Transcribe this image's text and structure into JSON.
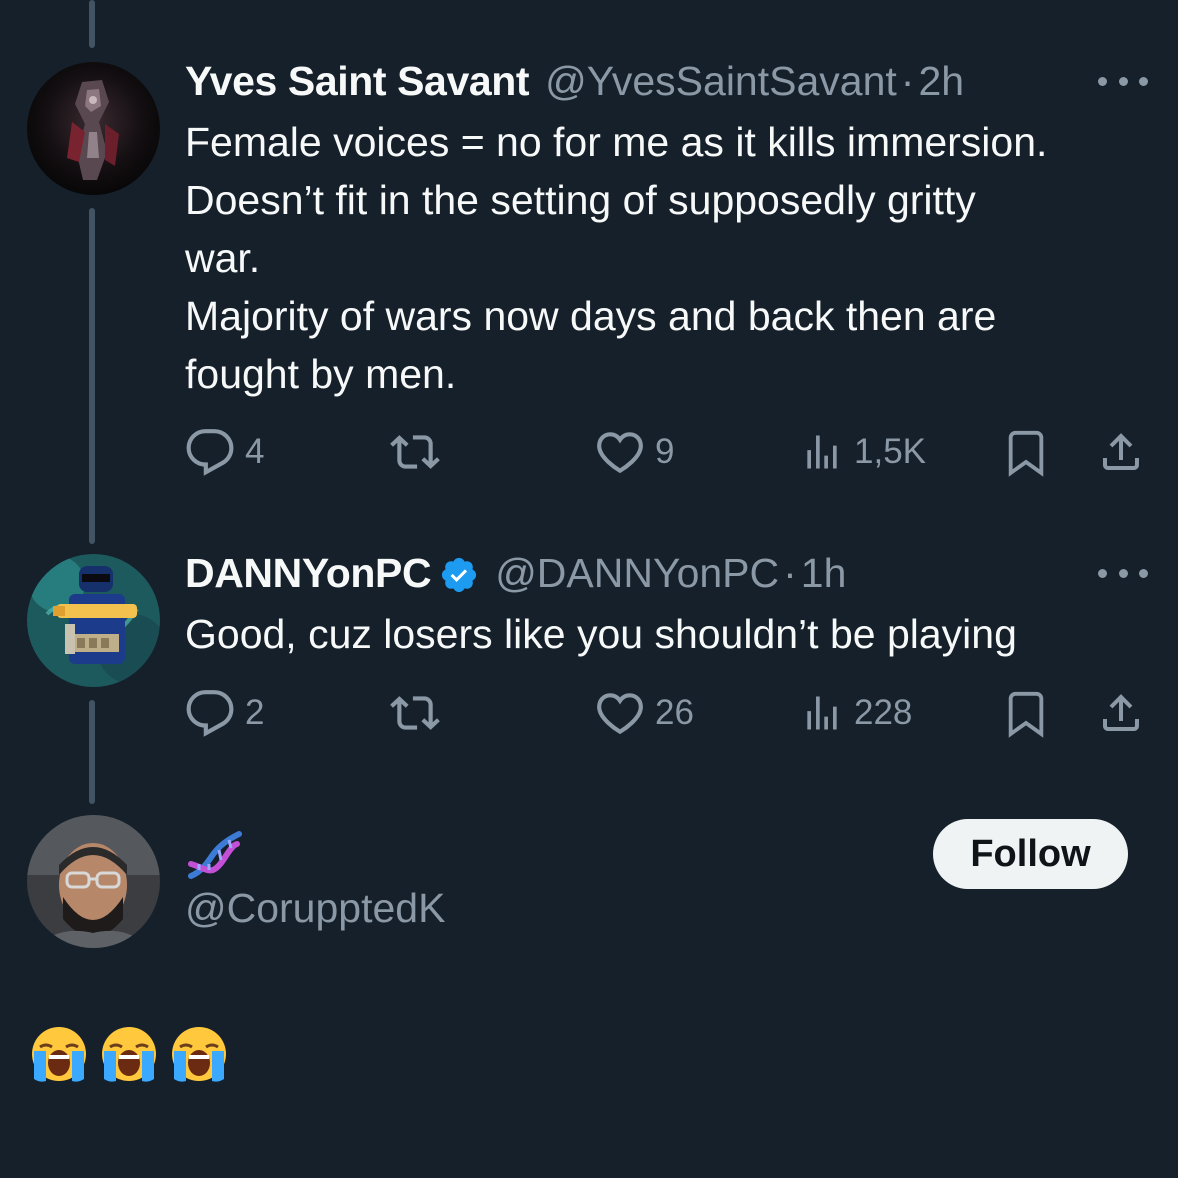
{
  "colors": {
    "background": "#15202b",
    "text_primary": "#f7f9f9",
    "text_secondary": "#8b98a5",
    "verified": "#1d9bf0",
    "thread_line": "#425364"
  },
  "tweets": [
    {
      "display_name": "Yves Saint Savant",
      "handle": "@YvesSaintSavant",
      "separator": "·",
      "time": "2h",
      "verified": false,
      "text_lines": [
        "Female voices = no for me as it kills immersion.",
        "Doesn’t fit in the setting of supposedly gritty",
        "war.",
        "Majority of wars now days and back then are",
        "fought by men."
      ],
      "actions": {
        "replies": "4",
        "reposts": "",
        "likes": "9",
        "views": "1,5K"
      },
      "icons": [
        "reply-icon",
        "repost-icon",
        "like-icon",
        "views-icon",
        "bookmark-icon",
        "share-icon",
        "more-icon"
      ]
    },
    {
      "display_name": "DANNYonPC",
      "handle": "@DANNYonPC",
      "separator": "·",
      "time": "1h",
      "verified": true,
      "text_lines": [
        "Good, cuz losers like you shouldn’t be playing"
      ],
      "actions": {
        "replies": "2",
        "reposts": "",
        "likes": "26",
        "views": "228"
      },
      "icons": [
        "reply-icon",
        "repost-icon",
        "like-icon",
        "views-icon",
        "bookmark-icon",
        "share-icon",
        "more-icon"
      ]
    }
  ],
  "focused_reply": {
    "display_name_icon": "dna-emoji-icon",
    "handle": "@CorupptedK",
    "follow_label": "Follow",
    "body_emoji": [
      "loudly-crying-face-emoji",
      "loudly-crying-face-emoji",
      "loudly-crying-face-emoji"
    ]
  }
}
